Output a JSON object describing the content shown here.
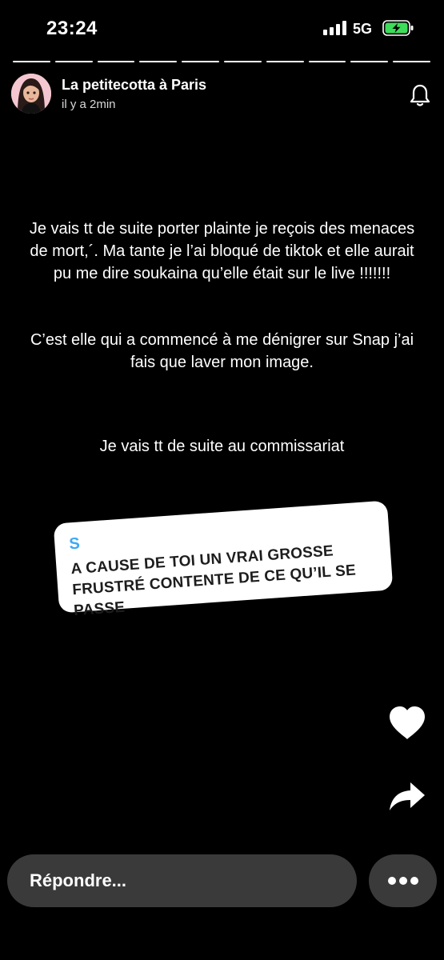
{
  "status_bar": {
    "time": "23:24",
    "network": "5G",
    "icons": [
      "signal-icon",
      "battery-charging-icon"
    ],
    "battery_color": "#3ddc5a"
  },
  "story": {
    "author": "La petitecotta à Paris",
    "posted": "il y a 2min",
    "segments_total": 10,
    "paragraphs": [
      "Je vais tt de suite porter plainte je reçois des menaces de mort,´. Ma tante je l’ai bloqué de tiktok et elle aurait pu me dire soukaina qu’elle était sur le live !!!!!!!",
      "C’est elle qui a commencé à me dénigrer sur Snap j’ai fais que laver mon image.",
      "Je vais tt de suite au commissariat"
    ]
  },
  "question_card": {
    "initial": "S",
    "initial_color": "#3fa8f5",
    "text": "A CAUSE DE TOI UN VRAI GROSSE FRUSTRÉ CONTENTE DE CE QU’IL SE PASSE"
  },
  "actions": {
    "icons": [
      "bell-icon",
      "heart-icon",
      "share-icon",
      "more-icon"
    ]
  },
  "reply": {
    "placeholder": "Répondre..."
  }
}
